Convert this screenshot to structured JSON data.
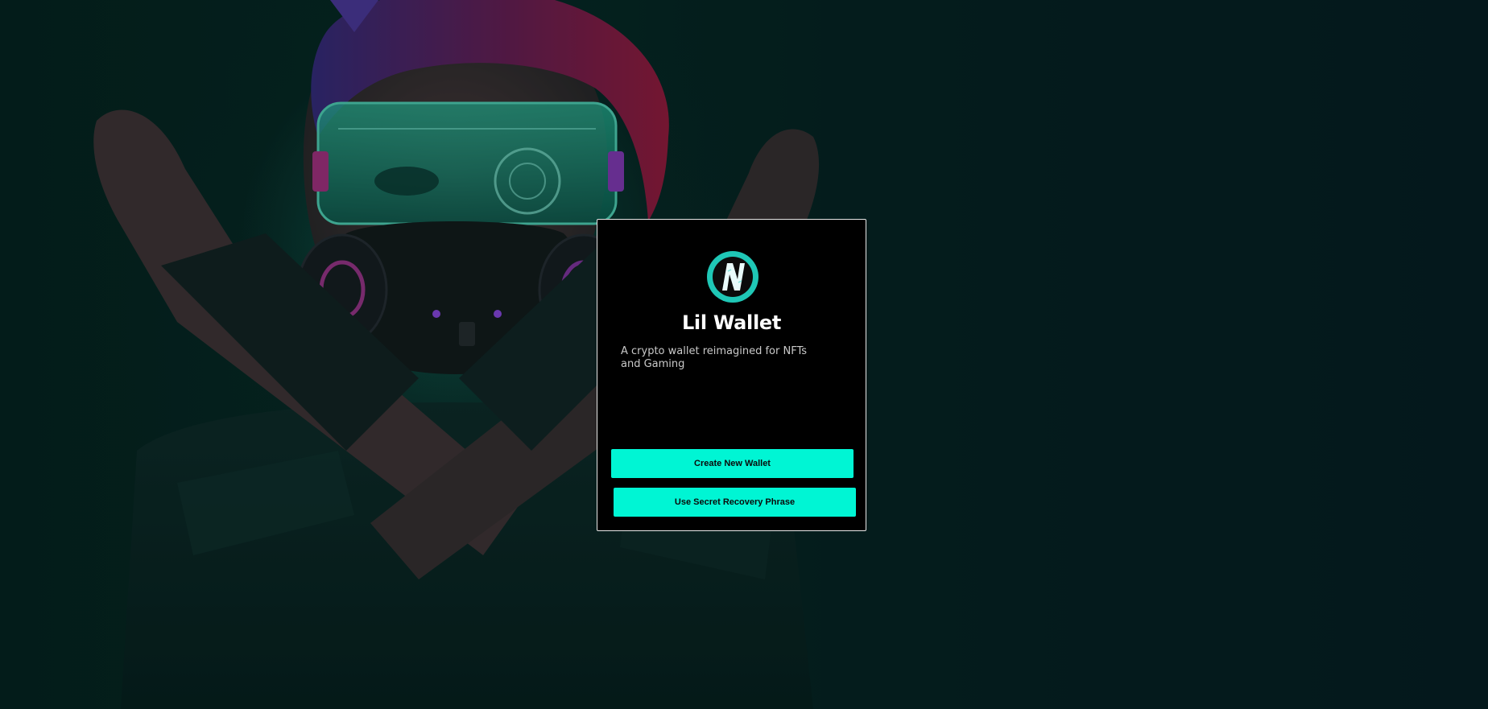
{
  "app": {
    "title": "Lil Wallet",
    "logo_letter": "N",
    "subtitle": "A crypto wallet reimagined for NFTs and Gaming"
  },
  "actions": {
    "create_label": "Create New Wallet",
    "recover_label": "Use Secret Recovery Phrase"
  },
  "colors": {
    "accent": "#00f5d4",
    "logo_ring": "#1fc7b6",
    "card_bg": "#000000",
    "card_border": "#e8e8e8",
    "page_bg": "#041a18"
  },
  "icons": {
    "logo": "lil-wallet-logo-icon"
  }
}
